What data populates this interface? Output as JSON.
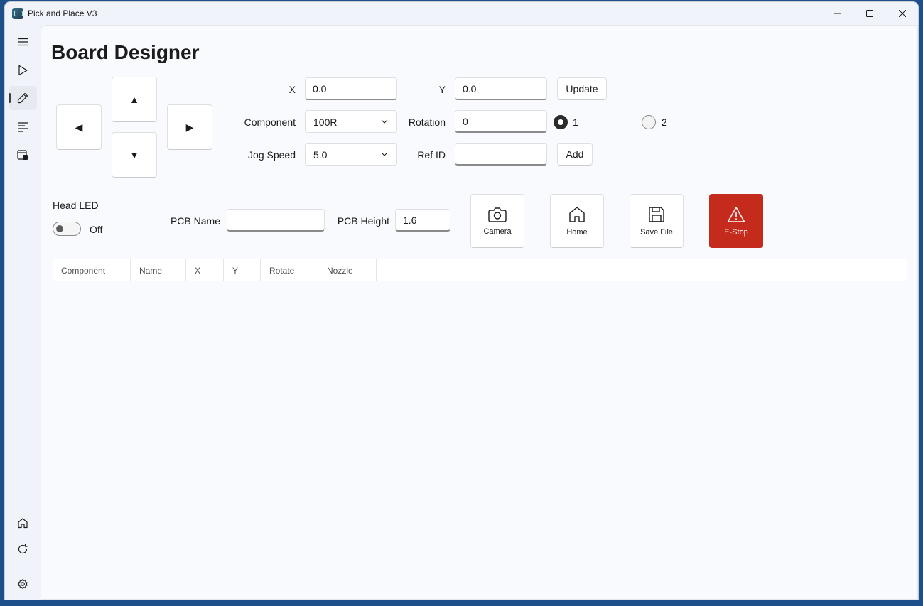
{
  "window": {
    "title": "Pick and Place V3"
  },
  "colors": {
    "estop": "#c42b1c",
    "accent": "#2b2b2b"
  },
  "sidebar": {
    "items": [
      {
        "icon": "hamburger-menu-icon"
      },
      {
        "icon": "play-icon"
      },
      {
        "icon": "pencil-icon",
        "active": true
      },
      {
        "icon": "list-icon"
      },
      {
        "icon": "board-icon"
      },
      {
        "icon": "home-icon"
      },
      {
        "icon": "refresh-icon"
      },
      {
        "icon": "gear-icon"
      }
    ]
  },
  "page": {
    "title": "Board Designer"
  },
  "jog": {
    "up": "▲",
    "down": "▼",
    "left": "◀",
    "right": "▶"
  },
  "form": {
    "x_label": "X",
    "x_value": "0.0",
    "y_label": "Y",
    "y_value": "0.0",
    "update_label": "Update",
    "component_label": "Component",
    "component_value": "100R",
    "rotation_label": "Rotation",
    "rotation_value": "0",
    "nozzle_options": [
      {
        "label": "1",
        "selected": true
      },
      {
        "label": "2",
        "selected": false
      }
    ],
    "jog_speed_label": "Jog Speed",
    "jog_speed_value": "5.0",
    "ref_id_label": "Ref ID",
    "ref_id_value": "",
    "add_label": "Add"
  },
  "head_led": {
    "label": "Head LED",
    "state": "Off"
  },
  "pcb": {
    "name_label": "PCB Name",
    "name_value": "",
    "height_label": "PCB Height",
    "height_value": "1.6"
  },
  "actions": {
    "camera": "Camera",
    "home": "Home",
    "save": "Save File",
    "estop": "E-Stop"
  },
  "table": {
    "columns": [
      "Component",
      "Name",
      "X",
      "Y",
      "Rotate",
      "Nozzle"
    ],
    "rows": []
  }
}
